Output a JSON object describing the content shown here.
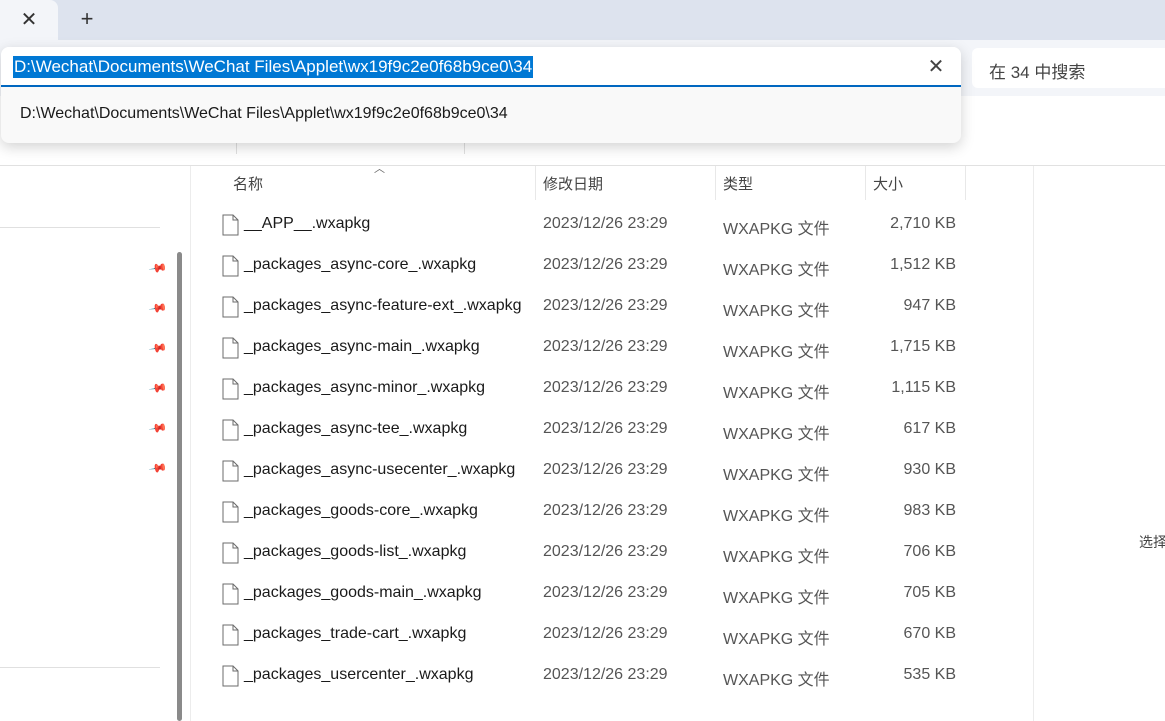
{
  "tab": {
    "close_icon": "close-icon",
    "new_tab_icon": "plus-icon"
  },
  "address": {
    "value": "D:\\Wechat\\Documents\\WeChat Files\\Applet\\wx19f9c2e0f68b9ce0\\34",
    "suggestion": "D:\\Wechat\\Documents\\WeChat Files\\Applet\\wx19f9c2e0f68b9ce0\\34"
  },
  "search": {
    "placeholder": "在 34 中搜索"
  },
  "columns": {
    "name": "名称",
    "date": "修改日期",
    "type": "类型",
    "size": "大小"
  },
  "files": [
    {
      "name": "__APP__.wxapkg",
      "date": "2023/12/26 23:29",
      "type": "WXAPKG 文件",
      "size": "2,710 KB"
    },
    {
      "name": "_packages_async-core_.wxapkg",
      "date": "2023/12/26 23:29",
      "type": "WXAPKG 文件",
      "size": "1,512 KB"
    },
    {
      "name": "_packages_async-feature-ext_.wxapkg",
      "date": "2023/12/26 23:29",
      "type": "WXAPKG 文件",
      "size": "947 KB"
    },
    {
      "name": "_packages_async-main_.wxapkg",
      "date": "2023/12/26 23:29",
      "type": "WXAPKG 文件",
      "size": "1,715 KB"
    },
    {
      "name": "_packages_async-minor_.wxapkg",
      "date": "2023/12/26 23:29",
      "type": "WXAPKG 文件",
      "size": "1,115 KB"
    },
    {
      "name": "_packages_async-tee_.wxapkg",
      "date": "2023/12/26 23:29",
      "type": "WXAPKG 文件",
      "size": "617 KB"
    },
    {
      "name": "_packages_async-usecenter_.wxapkg",
      "date": "2023/12/26 23:29",
      "type": "WXAPKG 文件",
      "size": "930 KB"
    },
    {
      "name": "_packages_goods-core_.wxapkg",
      "date": "2023/12/26 23:29",
      "type": "WXAPKG 文件",
      "size": "983 KB"
    },
    {
      "name": "_packages_goods-list_.wxapkg",
      "date": "2023/12/26 23:29",
      "type": "WXAPKG 文件",
      "size": "706 KB"
    },
    {
      "name": "_packages_goods-main_.wxapkg",
      "date": "2023/12/26 23:29",
      "type": "WXAPKG 文件",
      "size": "705 KB"
    },
    {
      "name": "_packages_trade-cart_.wxapkg",
      "date": "2023/12/26 23:29",
      "type": "WXAPKG 文件",
      "size": "670 KB"
    },
    {
      "name": "_packages_usercenter_.wxapkg",
      "date": "2023/12/26 23:29",
      "type": "WXAPKG 文件",
      "size": "535 KB"
    }
  ],
  "details_hint": "选择",
  "colors": {
    "accent": "#0078d4",
    "selection_text": "#ffffff",
    "tab_strip": "#dde3ee"
  }
}
